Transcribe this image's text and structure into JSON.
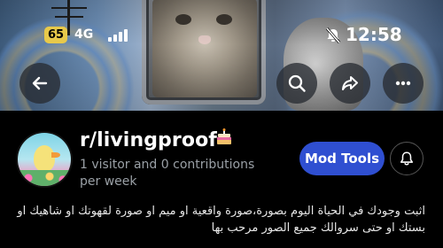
{
  "status_bar": {
    "badge": "65",
    "network": "4G",
    "time": "12:58"
  },
  "icons": {
    "back": "back-arrow-icon",
    "search": "search-icon",
    "share": "share-icon",
    "more": "more-horizontal-icon",
    "bell": "bell-icon",
    "cake": "cake-icon"
  },
  "subreddit": {
    "name": "r/livingproof",
    "stats": "1 visitor and 0 contributions per week",
    "description": "اثبت وجودك في الحياة اليوم بصورة،صورة واقعية او ميم او صورة لقهوتك او شاهيك او بستك او حتى سروالك جميع الصور مرحب بها"
  },
  "actions": {
    "mod_tools": "Mod Tools"
  },
  "colors": {
    "accent": "#2f4fd1",
    "badge": "#e8c94a",
    "background": "#000000"
  }
}
